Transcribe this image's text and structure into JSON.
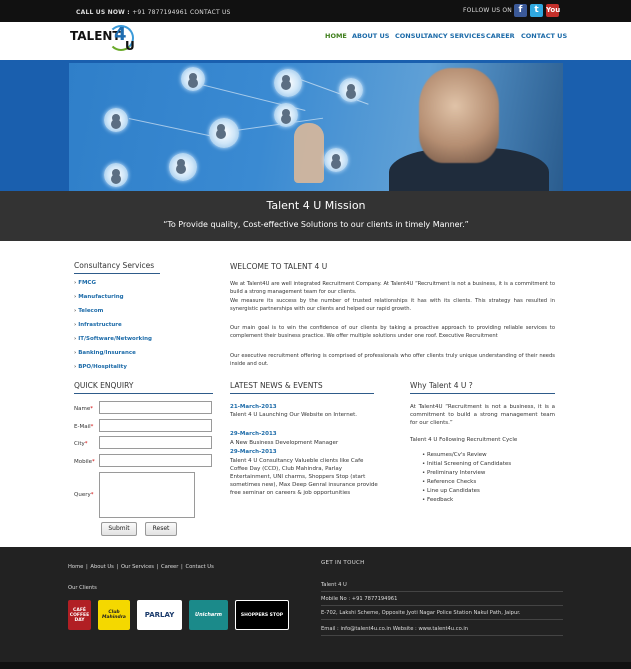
{
  "topbar": {
    "call_label": "CALL US NOW :",
    "call_number": "+91 7877194961",
    "contact_label": "CONTACT US",
    "follow_label": "FOLLOW US ON",
    "social": [
      "f",
      "t",
      "You"
    ]
  },
  "logo": {
    "text": "TALENT",
    "number": "4",
    "letter": "U"
  },
  "nav": [
    "HOME",
    "ABOUT US",
    "CONSULTANCY SERVICES",
    "CAREER",
    "CONTACT US"
  ],
  "mission": {
    "title": "Talent 4 U Mission",
    "text": "“To Provide quality, Cost-effective Solutions to our clients in timely Manner.”"
  },
  "consultancy": {
    "title": "Consultancy Services",
    "items": [
      "FMCG",
      "Manufacturing",
      "Telecom",
      "Infrastructure",
      "IT/Software/Networking",
      "Banking/Insurance",
      "BPO/Hospitality"
    ]
  },
  "enquiry": {
    "title": "QUICK ENQUIRY",
    "fields": [
      "Name",
      "E-Mail",
      "City",
      "Mobile",
      "Query"
    ],
    "required_mark": "*",
    "submit": "Submit",
    "reset": "Reset"
  },
  "welcome": {
    "title": "WELCOME TO TALENT 4 U",
    "p1": "We at Talent4U are well integrated Recruitment Company. At Talent4U “Recruitment is not a business, it is a commitment to build a strong management team for our clients.",
    "p2": "We measure its success by the number of trusted relationships it has with its clients. This strategy has resulted in synergistic partnerships with our clients and helped our rapid growth.",
    "p3": "Our main goal is to win the confidence of our clients by taking a proactive approach to providing reliable services to complement their business practice. We offer multiple solutions under one roof. Executive Recruitment",
    "p4": "Our executive recruitment offering is comprised of professionals who offer clients truly unique understanding of their needs inside and out."
  },
  "news": {
    "title": "LATEST NEWS & EVENTS",
    "items": [
      {
        "date": "21-March-2013",
        "text": "Talent 4 U Launching Our Website on Internet."
      },
      {
        "date": "29-March-2013",
        "text": "A New Business Development Manager"
      },
      {
        "date": "29-March-2013",
        "text": "Talent 4 U Consultancy Valueble clients like Cafe Coffee Day (CCD), Club Mahindra, Parlay Entertainment, UNI charms, Shoppers Stop (start sometimes new), Max Deep Genral insurance provide free seminar on careers & job opportunities"
      }
    ]
  },
  "why": {
    "title": "Why Talent 4 U ?",
    "text": "At Talent4U “Recruitment is not a business, it is a commitment to build a strong management team for our clients.”",
    "cycle_title": "Talent 4 U Following Recruitment Cycle",
    "cycle": [
      "Resumes/Cv's Review",
      "Initial Screening of Candidates",
      "Preliminary Interview",
      "Reference Checks",
      "Line up Candidates",
      "Feedback"
    ]
  },
  "footer": {
    "links": [
      "Home",
      "About Us",
      "Our Services",
      "Career",
      "Contact Us"
    ],
    "separator": "|",
    "clients_label": "Our Clients",
    "clients": [
      "CAFÉ COFFEE DAY",
      "Club Mahindra",
      "PARLAY",
      "Unicharm",
      "SHOPPERS STOP"
    ],
    "get_in_touch": "GET IN TOUCH",
    "company": "Talent 4 U",
    "mobile": "Mobile No : +91 7877194961",
    "address": "E-702, Lakshi Scheme, Opposite Jyoti Nagar Police Station Nakul Path, Jaipur.",
    "email_web": "Email : info@talent4u.co.in Website : www.talent4u.co.in"
  }
}
